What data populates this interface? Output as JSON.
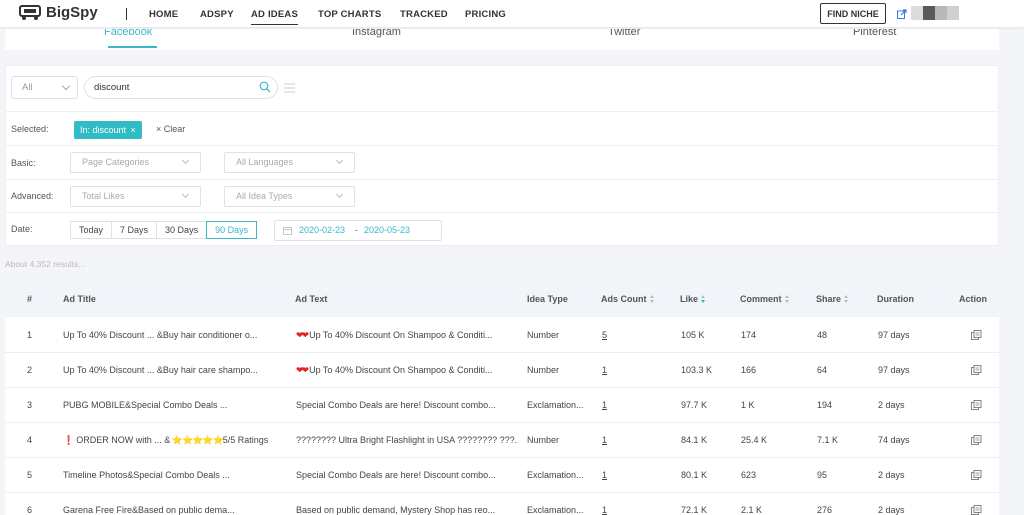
{
  "brand": {
    "name": "BigSpy"
  },
  "nav": {
    "items": [
      {
        "label": "HOME",
        "active": false
      },
      {
        "label": "ADSPY",
        "active": false
      },
      {
        "label": "AD IDEAS",
        "active": true
      },
      {
        "label": "TOP CHARTS",
        "active": false
      },
      {
        "label": "TRACKED",
        "active": false
      },
      {
        "label": "PRICING",
        "active": false
      }
    ],
    "find_niche": "FIND NICHE"
  },
  "platform_tabs": [
    {
      "label": "Facebook",
      "active": true
    },
    {
      "label": "Instagram",
      "active": false
    },
    {
      "label": "Twitter",
      "active": false
    },
    {
      "label": "Pinterest",
      "active": false
    }
  ],
  "search": {
    "scope": "All",
    "query": "discount"
  },
  "filters": {
    "selected_label": "Selected:",
    "selected_chip": "In: discount",
    "clear_label": "Clear",
    "basic_label": "Basic:",
    "page_categories": "Page Categories",
    "all_languages": "All Languages",
    "advanced_label": "Advanced:",
    "total_likes": "Total Likes",
    "all_idea_types": "All Idea Types",
    "date_label": "Date:",
    "date_buttons": [
      {
        "label": "Today",
        "active": false
      },
      {
        "label": "7 Days",
        "active": false
      },
      {
        "label": "30 Days",
        "active": false
      },
      {
        "label": "90 Days",
        "active": true
      }
    ],
    "date_start": "2020-02-23",
    "date_sep": "-",
    "date_end": "2020-05-23"
  },
  "results_count": "About 4,352 results...",
  "table": {
    "headers": {
      "num": "#",
      "ad_title": "Ad Title",
      "ad_text": "Ad Text",
      "idea_type": "Idea Type",
      "ads_count": "Ads Count",
      "like": "Like",
      "comment": "Comment",
      "share": "Share",
      "duration": "Duration",
      "action": "Action"
    },
    "rows": [
      {
        "num": "1",
        "title": "Up To 40% Discount ... &Buy hair conditioner o...",
        "text": "Up To 40% Discount On Shampoo & Conditi...",
        "text_prefix": "hearts",
        "idea_type": "Number",
        "ads_count": "5",
        "like": "105 K",
        "comment": "174",
        "share": "48",
        "duration": "97 days"
      },
      {
        "num": "2",
        "title": "Up To 40% Discount ... &Buy hair care shampo...",
        "text": "Up To 40% Discount On Shampoo & Conditi...",
        "text_prefix": "hearts",
        "idea_type": "Number",
        "ads_count": "1",
        "like": "103.3 K",
        "comment": "166",
        "share": "64",
        "duration": "97 days"
      },
      {
        "num": "3",
        "title": "PUBG MOBILE&Special Combo Deals ...",
        "text": "Special Combo Deals are here! Discount combo...",
        "text_prefix": "",
        "idea_type": "Exclamation...",
        "ads_count": "1",
        "like": "97.7 K",
        "comment": "1 K",
        "share": "194",
        "duration": "2 days"
      },
      {
        "num": "4",
        "title": "ORDER NOW with ... &",
        "title_suffix": "5/5 Ratings",
        "title_prefix": "excl",
        "text": "???????? Ultra Bright Flashlight in USA ???????? ???...",
        "text_prefix": "",
        "idea_type": "Number",
        "ads_count": "1",
        "like": "84.1 K",
        "comment": "25.4 K",
        "share": "7.1 K",
        "duration": "74 days"
      },
      {
        "num": "5",
        "title": "Timeline Photos&Special Combo Deals ...",
        "text": "Special Combo Deals are here! Discount combo...",
        "text_prefix": "",
        "idea_type": "Exclamation...",
        "ads_count": "1",
        "like": "80.1 K",
        "comment": "623",
        "share": "95",
        "duration": "2 days"
      },
      {
        "num": "6",
        "title": "Garena Free Fire&Based on public dema...",
        "text": "Based on public demand, Mystery Shop has reo...",
        "text_prefix": "",
        "idea_type": "Exclamation...",
        "ads_count": "1",
        "like": "72.1 K",
        "comment": "2.1 K",
        "share": "276",
        "duration": "2 days"
      }
    ]
  },
  "colors": {
    "accent": "#3ab8c8",
    "chip": "#2fbcc5"
  }
}
